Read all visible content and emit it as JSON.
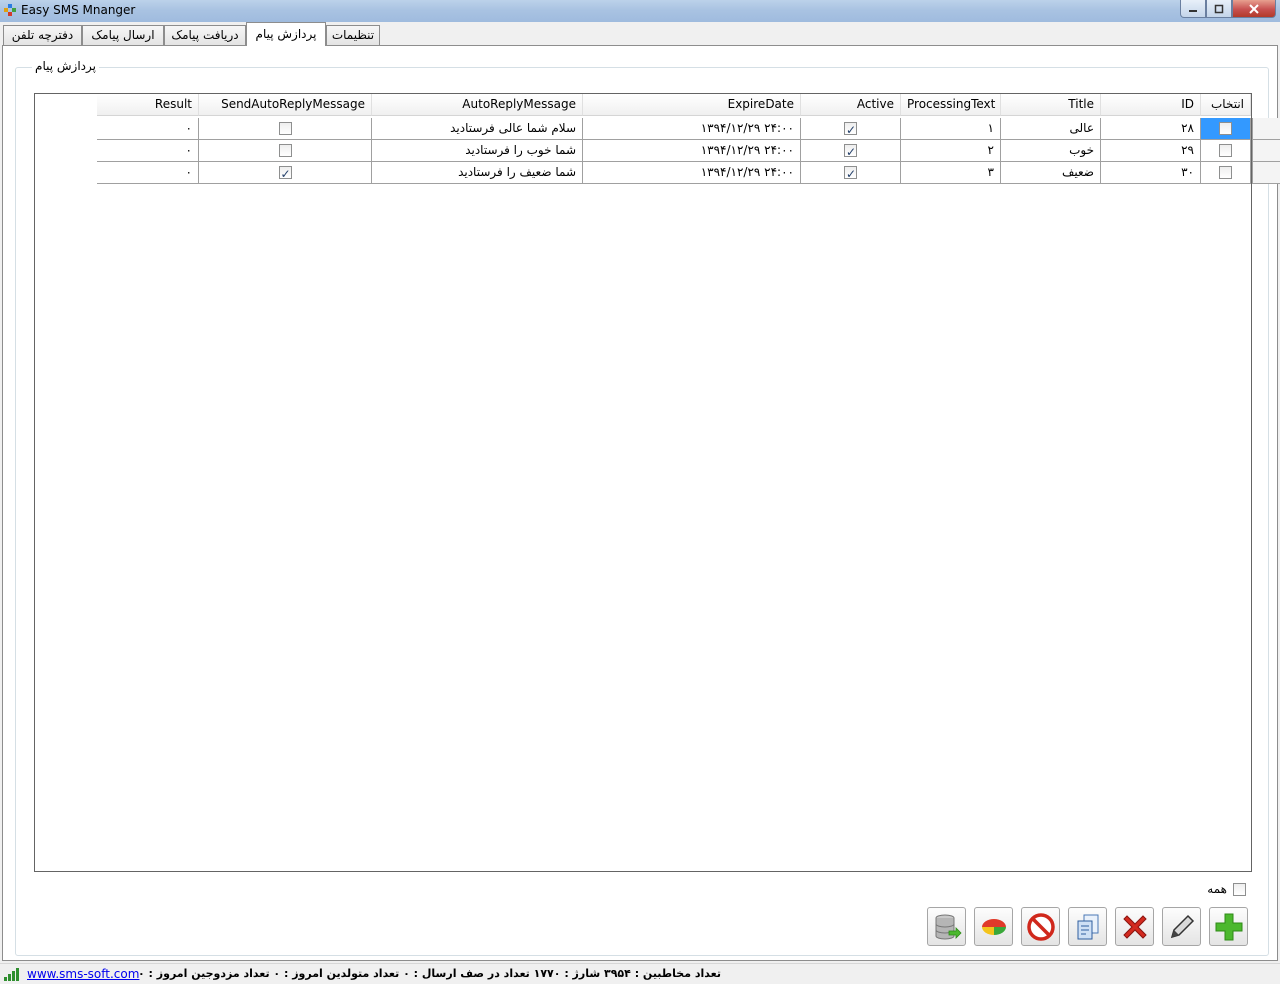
{
  "window": {
    "title": "Easy SMS Mnanger"
  },
  "tabs": [
    {
      "label": "تنظیمات"
    },
    {
      "label": "پردازش پیام"
    },
    {
      "label": "دریافت پیامک"
    },
    {
      "label": "ارسال پیامک"
    },
    {
      "label": "دفترچه تلفن"
    }
  ],
  "active_tab": "پردازش پیام",
  "group": {
    "title": "پردازش پیام"
  },
  "grid": {
    "columns": [
      "انتخاب",
      "ID",
      "Title",
      "ProcessingText",
      "Active",
      "ExpireDate",
      "AutoReplyMessage",
      "SendAutoReplyMessage",
      "Result"
    ],
    "rows": [
      {
        "select": false,
        "id": "۲۸",
        "title": "عالی",
        "processing_text": "۱",
        "active": true,
        "expire_date": "۱۳۹۴/۱۲/۲۹ ۲۴:۰۰",
        "auto_reply": "سلام شما عالی فرستادید",
        "send_auto_reply": false,
        "result": "۰"
      },
      {
        "select": false,
        "id": "۲۹",
        "title": "خوب",
        "processing_text": "۲",
        "active": true,
        "expire_date": "۱۳۹۴/۱۲/۲۹ ۲۴:۰۰",
        "auto_reply": "شما خوب را فرستادید",
        "send_auto_reply": false,
        "result": "۰"
      },
      {
        "select": false,
        "id": "۳۰",
        "title": "ضعیف",
        "processing_text": "۳",
        "active": true,
        "expire_date": "۱۳۹۴/۱۲/۲۹ ۲۴:۰۰",
        "auto_reply": "شما ضعیف را فرستادید",
        "send_auto_reply": true,
        "result": "۰"
      }
    ]
  },
  "select_all": {
    "label": "همه",
    "checked": false
  },
  "toolbar": [
    "add-icon",
    "edit-icon",
    "delete-icon",
    "copy-icon",
    "block-icon",
    "chart-icon",
    "database-export-icon"
  ],
  "status": {
    "link": "www.sms-soft.com",
    "stats": "تعداد مخاطبین : ۳۹۵۴  شارژ : ۱۷۷۰  تعداد در صف ارسال : ۰  تعداد متولدین امروز : ۰  تعداد مزدوجین امروز : ۰"
  }
}
